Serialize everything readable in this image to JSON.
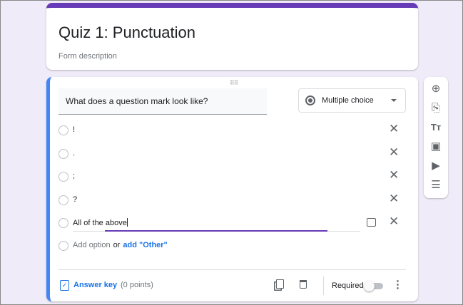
{
  "form": {
    "title": "Quiz 1: Punctuation",
    "description": "Form description"
  },
  "question": {
    "text": "What does a question mark look like?",
    "type": "Multiple choice",
    "options": [
      "!",
      ".",
      ";",
      "?",
      "All of the above"
    ],
    "add_option": "Add option",
    "or": "or",
    "add_other": "add \"Other\""
  },
  "footer": {
    "answer_key": "Answer key",
    "points": "(0 points)",
    "required": "Required",
    "required_on": false
  },
  "toolbar": [
    "add-question",
    "import-questions",
    "add-title",
    "add-image",
    "add-video",
    "add-section"
  ],
  "colors": {
    "accent": "#673ab7",
    "active": "#4285f4",
    "bg": "#f0ebf8"
  }
}
